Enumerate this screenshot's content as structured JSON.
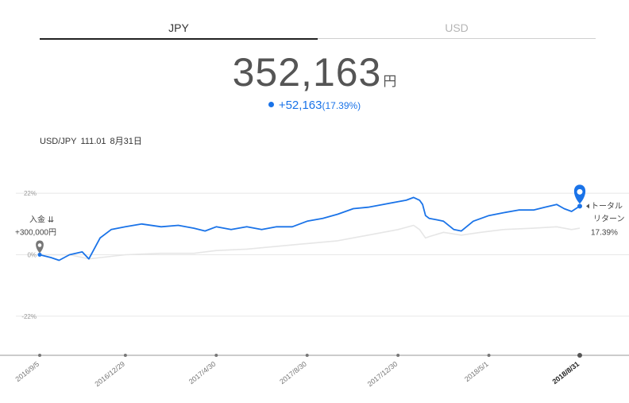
{
  "tabs": [
    {
      "label": "JPY",
      "active": true
    },
    {
      "label": "USD",
      "active": false
    }
  ],
  "value": {
    "amount": "352,163",
    "unit": "円"
  },
  "change": {
    "amount": "+52,163",
    "percent": "(17.39%)"
  },
  "rate": {
    "pair": "USD/JPY",
    "value": "111.01",
    "date": "8月31日"
  },
  "colors": {
    "accent": "#1a73e8",
    "benchmark": "#e6e6e6",
    "grid": "#e8e8e8",
    "pin_gray": "#777777"
  },
  "icons": {
    "deposit": "map-pin-icon",
    "current": "map-pin-icon",
    "arrow": "triangle-left-icon"
  },
  "chart_data": {
    "type": "line",
    "y_unit": "%",
    "yticks": [
      "22%",
      "0%",
      "-22%"
    ],
    "ylim": [
      -36,
      30
    ],
    "x": [
      "2016/9/5",
      "2016/12/29",
      "2017/4/30",
      "2017/8/30",
      "2017/12/30",
      "2018/5/1",
      "2018/8/31"
    ],
    "xlim_dates": [
      "2016/9/5",
      "2018/8/31"
    ],
    "grid": true,
    "series": [
      {
        "role": "portfolio",
        "color": "#1a73e8",
        "values": [
          [
            "2016/9/5",
            0
          ],
          [
            "2016/9/20",
            -1
          ],
          [
            "2016/10/1",
            -2
          ],
          [
            "2016/10/15",
            0
          ],
          [
            "2016/11/1",
            1
          ],
          [
            "2016/11/10",
            -1.5
          ],
          [
            "2016/11/25",
            6
          ],
          [
            "2016/12/10",
            9
          ],
          [
            "2016/12/29",
            10
          ],
          [
            "2017/1/20",
            11
          ],
          [
            "2017/2/15",
            10
          ],
          [
            "2017/3/10",
            10.5
          ],
          [
            "2017/3/31",
            9.5
          ],
          [
            "2017/4/15",
            8.5
          ],
          [
            "2017/4/30",
            10
          ],
          [
            "2017/5/20",
            9
          ],
          [
            "2017/6/10",
            10
          ],
          [
            "2017/6/30",
            9
          ],
          [
            "2017/7/20",
            10
          ],
          [
            "2017/8/10",
            10
          ],
          [
            "2017/8/30",
            12
          ],
          [
            "2017/9/20",
            13
          ],
          [
            "2017/10/10",
            14.5
          ],
          [
            "2017/10/31",
            16.5
          ],
          [
            "2017/11/20",
            17
          ],
          [
            "2017/12/10",
            18
          ],
          [
            "2017/12/30",
            19
          ],
          [
            "2018/1/10",
            19.5
          ],
          [
            "2018/1/20",
            20.5
          ],
          [
            "2018/1/28",
            19.5
          ],
          [
            "2018/2/1",
            18
          ],
          [
            "2018/2/5",
            14
          ],
          [
            "2018/2/10",
            13
          ],
          [
            "2018/2/20",
            12.5
          ],
          [
            "2018/3/1",
            12
          ],
          [
            "2018/3/15",
            9
          ],
          [
            "2018/3/25",
            8.5
          ],
          [
            "2018/4/10",
            12
          ],
          [
            "2018/5/1",
            14
          ],
          [
            "2018/5/20",
            15
          ],
          [
            "2018/6/10",
            16
          ],
          [
            "2018/6/30",
            16
          ],
          [
            "2018/7/15",
            17
          ],
          [
            "2018/7/31",
            18
          ],
          [
            "2018/8/10",
            16.5
          ],
          [
            "2018/8/20",
            15.5
          ],
          [
            "2018/8/31",
            17.39
          ]
        ]
      },
      {
        "role": "benchmark",
        "color": "#e6e6e6",
        "values": [
          [
            "2016/9/5",
            0
          ],
          [
            "2016/10/15",
            0
          ],
          [
            "2016/11/10",
            -1.5
          ],
          [
            "2016/12/29",
            0
          ],
          [
            "2017/2/15",
            0.5
          ],
          [
            "2017/3/31",
            0.5
          ],
          [
            "2017/4/30",
            1.5
          ],
          [
            "2017/6/10",
            2
          ],
          [
            "2017/7/20",
            3
          ],
          [
            "2017/8/30",
            4
          ],
          [
            "2017/10/10",
            5
          ],
          [
            "2017/11/20",
            7
          ],
          [
            "2017/12/30",
            9
          ],
          [
            "2018/1/20",
            10.5
          ],
          [
            "2018/1/28",
            9
          ],
          [
            "2018/2/5",
            6
          ],
          [
            "2018/2/10",
            6.5
          ],
          [
            "2018/3/1",
            8
          ],
          [
            "2018/3/25",
            7
          ],
          [
            "2018/4/20",
            8
          ],
          [
            "2018/5/20",
            9
          ],
          [
            "2018/6/30",
            9.5
          ],
          [
            "2018/7/31",
            10
          ],
          [
            "2018/8/20",
            9
          ],
          [
            "2018/8/31",
            9.5
          ]
        ]
      }
    ],
    "annotations": {
      "deposit": {
        "date": "2016/9/5",
        "value": 0,
        "label1": "入金",
        "label2": "+300,000円"
      },
      "end": {
        "date": "2018/8/31",
        "value": 17.39,
        "label1": "トータル",
        "label2": "リターン",
        "label3": "17.39%"
      }
    },
    "highlight_x": "2018/8/31"
  }
}
